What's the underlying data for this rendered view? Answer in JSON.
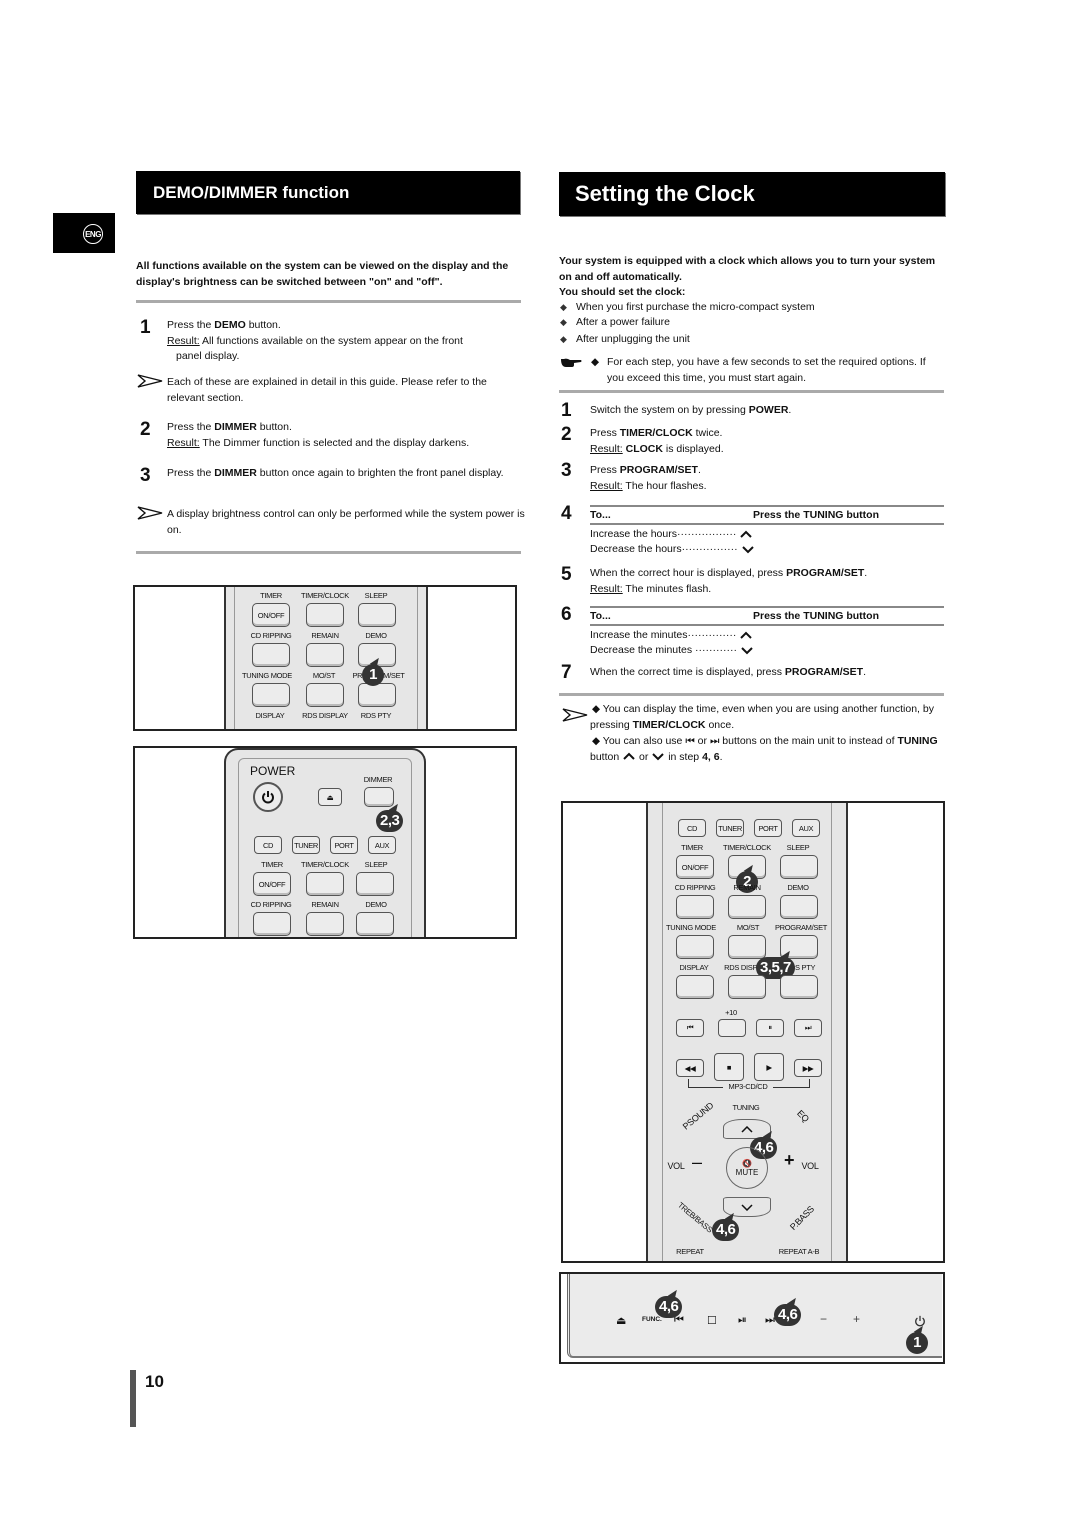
{
  "language_tab": "ENG",
  "left": {
    "title": "DEMO/DIMMER function",
    "intro": "All functions available on the system can be viewed on the display and the display's brightness can be switched between \"on\" and \"off\".",
    "steps": [
      {
        "num": "1",
        "pre": "Press the ",
        "bold": "DEMO",
        "post": " button.",
        "result_label": "Result:",
        "result": " All functions available on the system appear on the front",
        "result2": "panel display."
      },
      {
        "note": "Each of these are explained in detail in this guide. Please refer to the relevant section."
      },
      {
        "num": "2",
        "pre": "Press the ",
        "bold": "DIMMER",
        "post": " button.",
        "result_label": "Result:",
        "result": " The Dimmer function is selected and the display darkens."
      },
      {
        "num": "3",
        "pre": "Press the ",
        "bold": "DIMMER",
        "post": " button once again to brighten the front panel display."
      },
      {
        "note": "A display brightness control can only be performed while the system power is on."
      }
    ],
    "figure1": {
      "labels": [
        "TIMER",
        "TIMER/CLOCK",
        "SLEEP",
        "CD RIPPING",
        "REMAIN",
        "DEMO",
        "TUNING MODE",
        "MO/ST",
        "PROGRAM/SET",
        "DISPLAY",
        "RDS DISPLAY",
        "RDS PTY"
      ],
      "on_off": "ON/OFF",
      "callout": "1"
    },
    "figure2": {
      "power": "POWER",
      "dimmer": "DIMMER",
      "eject": "⏏",
      "sources": [
        "CD",
        "TUNER",
        "PORT",
        "AUX"
      ],
      "labels": [
        "TIMER",
        "TIMER/CLOCK",
        "SLEEP",
        "CD RIPPING",
        "REMAIN",
        "DEMO"
      ],
      "on_off": "ON/OFF",
      "callout": "2,3"
    }
  },
  "right": {
    "title": "Setting the Clock",
    "intro": "Your system is equipped with a clock which allows you to turn your system on and off automatically.",
    "should_set": "You should set the clock:",
    "bullets": [
      "When you first purchase the micro-compact system",
      "After a power failure",
      "After unplugging the unit"
    ],
    "hand_note": "For each step, you have a few seconds to set the required options. If you exceed this time, you must start again.",
    "steps": {
      "s1": {
        "num": "1",
        "pre": "Switch the system on by pressing ",
        "bold": "POWER",
        "post": "."
      },
      "s2": {
        "num": "2",
        "pre": "Press ",
        "bold": "TIMER/CLOCK",
        "post": " twice.",
        "result_label": "Result:",
        "result_bold": "CLOCK",
        "result": " is displayed."
      },
      "s3": {
        "num": "3",
        "pre": "Press ",
        "bold": "PROGRAM/SET",
        "post": ".",
        "result_label": "Result:",
        "result": " The hour flashes."
      },
      "s4": {
        "num": "4",
        "col1": "To...",
        "col2": "Press the TUNING button",
        "rows": [
          "Increase the hours",
          "Decrease the hours"
        ],
        "dots": [
          "·················",
          "················"
        ]
      },
      "s5": {
        "num": "5",
        "pre": "When the correct hour is displayed, press ",
        "bold": "PROGRAM/SET",
        "post": ".",
        "result_label": "Result:",
        "result": " The minutes flash."
      },
      "s6": {
        "num": "6",
        "col1": "To...",
        "col2": "Press the TUNING button",
        "rows": [
          "Increase the minutes",
          "Decrease the minutes"
        ],
        "dots": [
          "··············",
          " ············"
        ]
      },
      "s7": {
        "num": "7",
        "pre": "When the correct time is displayed, press ",
        "bold": "PROGRAM/SET",
        "post": "."
      }
    },
    "note1_pre": "◆ You can display the time, even when you are using another function, by pressing ",
    "note1_bold": "TIMER/CLOCK",
    "note1_post": " once.",
    "note2_pre": "◆ You can also use ",
    "note2_prev": "⏮",
    "note2_or": " or ",
    "note2_next": "⏭",
    "note2_mid": " buttons on the main unit to instead of ",
    "note2_bold": "TUNING",
    "note2_mid2": " button ",
    "note2_or2": " or ",
    "note2_end": " in step ",
    "note2_steps": "4, 6",
    "note2_dot": ".",
    "figure3": {
      "sources": [
        "CD",
        "TUNER",
        "PORT",
        "AUX"
      ],
      "labels": [
        "TIMER",
        "TIMER/CLOCK",
        "SLEEP",
        "CD RIPPING",
        "REMAIN",
        "DEMO",
        "TUNING MODE",
        "MO/ST",
        "PROGRAM/SET",
        "DISPLAY",
        "RDS DISPLAY",
        "RDS PTY"
      ],
      "on_off": "ON/OFF",
      "plus10": "+10",
      "mp3": "MP3-CD/CD",
      "tuning": "TUNING",
      "psound": "PSOUND",
      "eq": "EQ",
      "vol": "VOL",
      "mute": "MUTE",
      "treb": "TREB/BASS",
      "pbass": "P.BASS",
      "repeat": "REPEAT",
      "repeat_ab": "REPEAT A-B",
      "callouts": [
        "2",
        "3,5,7",
        "4,6",
        "4,6"
      ]
    },
    "figure4": {
      "func": "FUNC.",
      "callouts": [
        "4,6",
        "4,6",
        "1"
      ]
    }
  },
  "page_number": "10"
}
